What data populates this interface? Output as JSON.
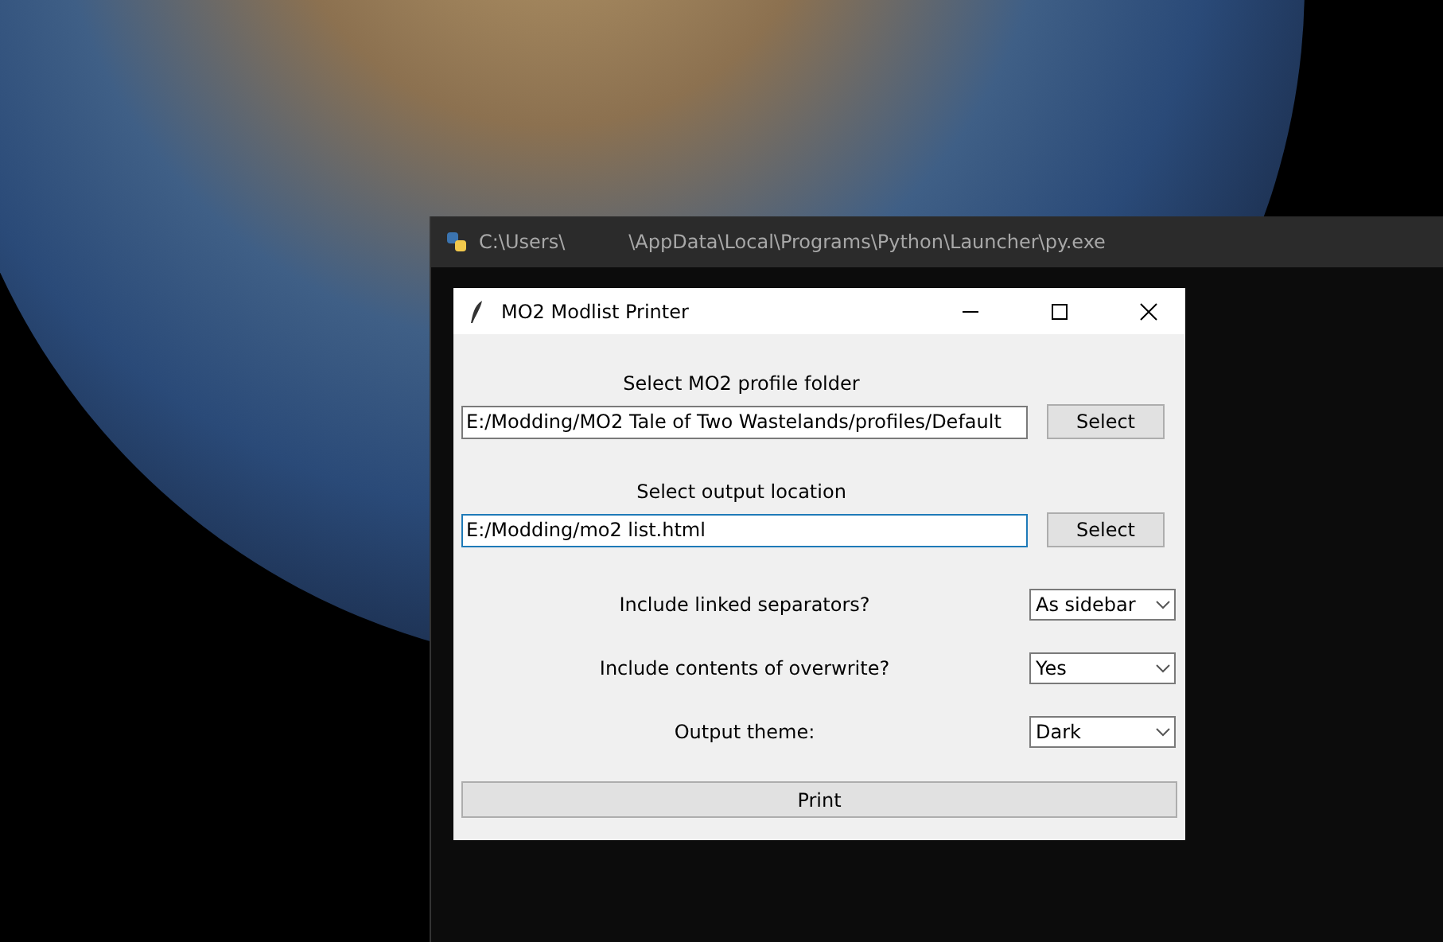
{
  "console_window": {
    "title_parts": [
      "C:\\Users\\",
      "\\AppData\\Local\\Programs\\Python\\Launcher\\py.exe"
    ]
  },
  "dialog": {
    "title": "MO2 Modlist Printer",
    "path_rows": [
      {
        "label": "Select MO2 profile folder",
        "value": "E:/Modding/MO2 Tale of Two Wastelands/profiles/Default",
        "focused": false,
        "button": "Select"
      },
      {
        "label": "Select output location",
        "value": "E:/Modding/mo2 list.html",
        "focused": true,
        "button": "Select"
      }
    ],
    "options": [
      {
        "label": "Include linked separators?",
        "value": "As sidebar"
      },
      {
        "label": "Include contents of overwrite?",
        "value": "Yes"
      },
      {
        "label": "Output theme:",
        "value": "Dark"
      }
    ],
    "print_button": "Print"
  }
}
